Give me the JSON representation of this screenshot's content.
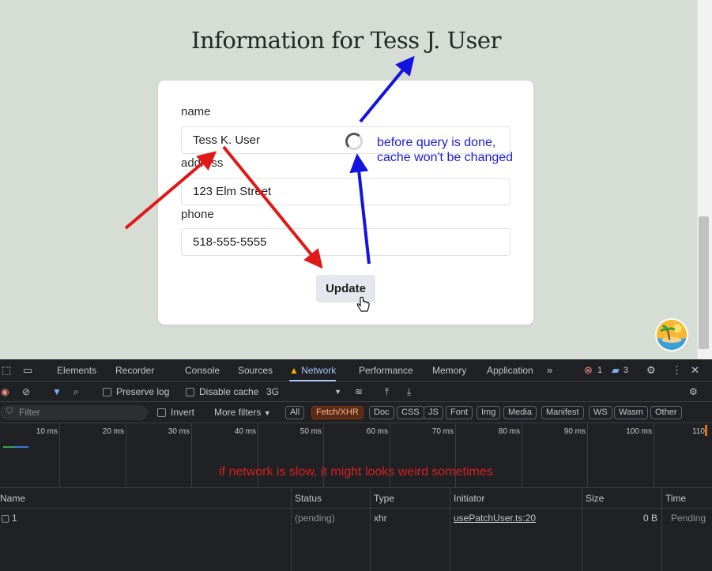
{
  "page": {
    "title": "Information for Tess J. User",
    "form": {
      "name_label": "name",
      "name_value": "Tess K. User",
      "address_label": "address",
      "address_value": "123 Elm Street",
      "phone_label": "phone",
      "phone_value": "518-555-5555",
      "update_label": "Update"
    }
  },
  "annotations": {
    "cache_note": "before query is done,\ncache won't be changed",
    "network_note": "if network is slow, it might looks weird sometimes",
    "colors": {
      "blue": "#1a1adb",
      "red": "#e01818"
    }
  },
  "devtools": {
    "tabs": [
      "Elements",
      "Recorder",
      "Console",
      "Sources",
      "Network",
      "Performance",
      "Memory",
      "Application"
    ],
    "active_tab": "Network",
    "error_count": "1",
    "message_count": "3",
    "toolbar": {
      "preserve_log": "Preserve log",
      "disable_cache": "Disable cache",
      "throttling": "3G"
    },
    "filter": {
      "placeholder": "Filter",
      "invert": "Invert",
      "more_filters": "More filters",
      "chips": [
        "All",
        "Fetch/XHR",
        "Doc",
        "CSS",
        "JS",
        "Font",
        "Img",
        "Media",
        "Manifest",
        "WS",
        "Wasm",
        "Other"
      ],
      "selected_chip": "Fetch/XHR"
    },
    "timeline_ticks": [
      "10 ms",
      "20 ms",
      "30 ms",
      "40 ms",
      "50 ms",
      "60 ms",
      "70 ms",
      "80 ms",
      "90 ms",
      "100 ms",
      "110"
    ],
    "table": {
      "columns": [
        "Name",
        "Status",
        "Type",
        "Initiator",
        "Size",
        "Time"
      ],
      "rows": [
        {
          "name": "1",
          "status": "(pending)",
          "type": "xhr",
          "initiator": "usePatchUser.ts:20",
          "size": "0 B",
          "time": "Pending"
        }
      ]
    }
  }
}
